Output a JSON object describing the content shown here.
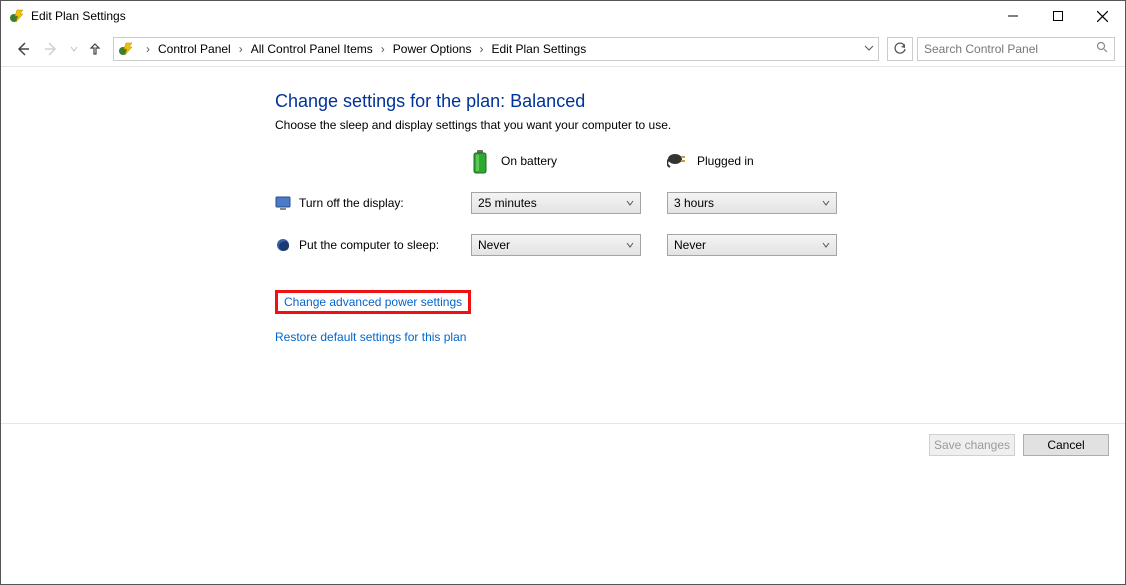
{
  "titlebar": {
    "title": "Edit Plan Settings"
  },
  "breadcrumbs": {
    "seg1": "Control Panel",
    "seg2": "All Control Panel Items",
    "seg3": "Power Options",
    "seg4": "Edit Plan Settings"
  },
  "search": {
    "placeholder": "Search Control Panel"
  },
  "heading": {
    "prefix": "Change settings for the plan: ",
    "plan": "Balanced"
  },
  "instruction": "Choose the sleep and display settings that you want your computer to use.",
  "columns": {
    "battery": "On battery",
    "plugged": "Plugged in"
  },
  "rows": {
    "display_label": "Turn off the display:",
    "sleep_label": "Put the computer to sleep:"
  },
  "values": {
    "display_battery": "25 minutes",
    "display_plugged": "3 hours",
    "sleep_battery": "Never",
    "sleep_plugged": "Never"
  },
  "links": {
    "advanced": "Change advanced power settings",
    "restore": "Restore default settings for this plan"
  },
  "buttons": {
    "save": "Save changes",
    "cancel": "Cancel"
  }
}
